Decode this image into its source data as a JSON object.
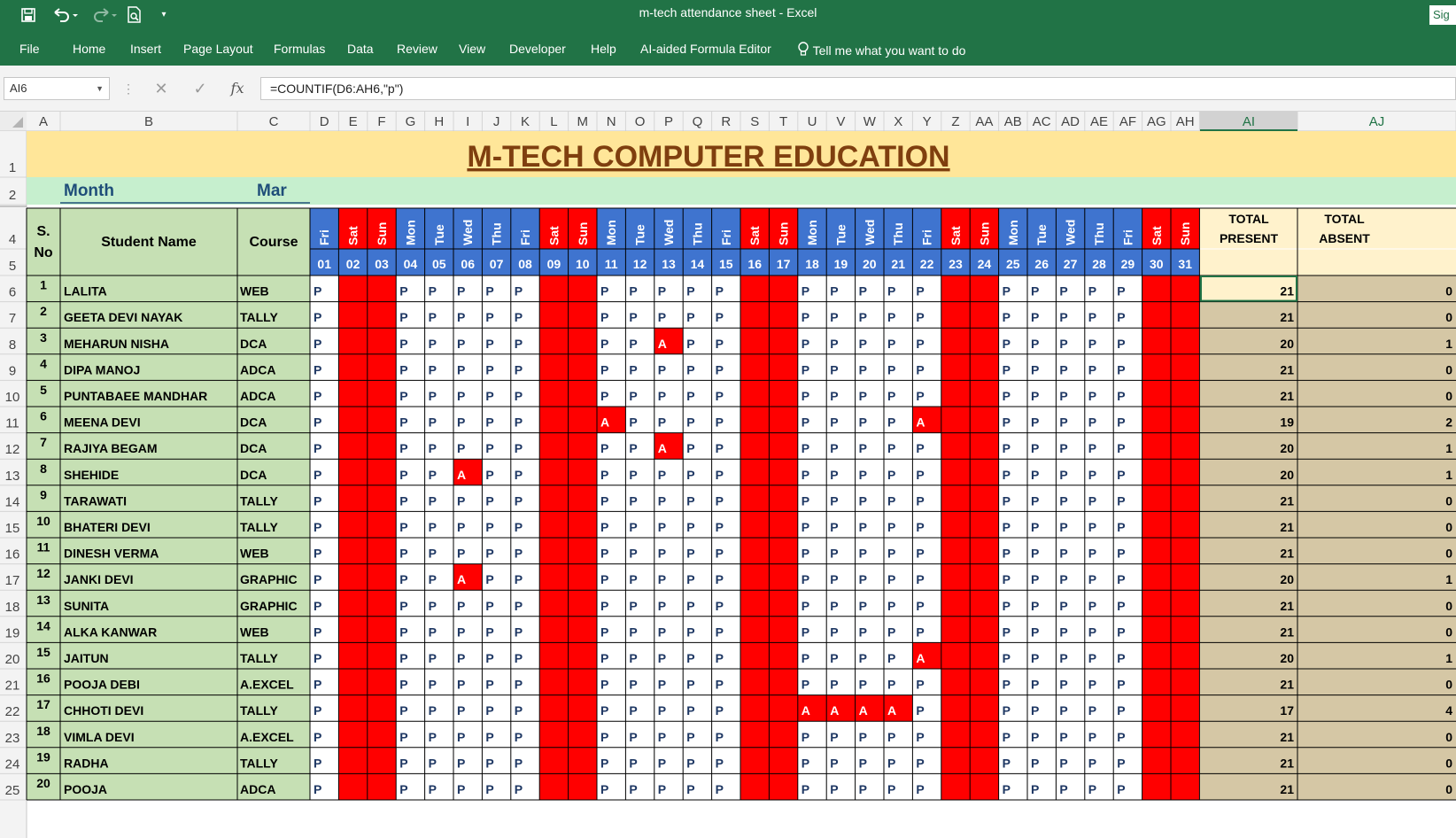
{
  "window": {
    "title": "m-tech attendance sheet  -  Excel",
    "sign_in": "Sig"
  },
  "quick_access": {
    "icons": [
      "save-icon",
      "undo-icon",
      "redo-icon",
      "print-preview-icon",
      "customize-icon"
    ]
  },
  "ribbon": {
    "tabs": [
      "File",
      "Home",
      "Insert",
      "Page Layout",
      "Formulas",
      "Data",
      "Review",
      "View",
      "Developer",
      "Help",
      "AI-aided Formula Editor",
      "Tell me what you want to do"
    ]
  },
  "formula_bar": {
    "name_box": "AI6",
    "formula": "=COUNTIF(D6:AH6,\"p\")",
    "fx_label": "fx"
  },
  "colors": {
    "excel_green": "#217346",
    "weekend_red": "#ff0000",
    "weekday_blue": "#3f74cf",
    "title_fill": "#ffe699",
    "title_text": "#7f3f0f",
    "student_fill": "#c6e0b4",
    "month_fill": "#c6efce",
    "total_present_fill": "#fff2cc",
    "total_absent_fill": "#d5c7a5"
  },
  "sheet": {
    "columns": [
      "A",
      "B",
      "C",
      "D",
      "E",
      "F",
      "G",
      "H",
      "I",
      "J",
      "K",
      "L",
      "M",
      "N",
      "O",
      "P",
      "Q",
      "R",
      "S",
      "T",
      "U",
      "V",
      "W",
      "X",
      "Y",
      "Z",
      "AA",
      "AB",
      "AC",
      "AD",
      "AE",
      "AF",
      "AG",
      "AH",
      "AI",
      "AJ"
    ],
    "row_numbers": [
      "1",
      "2",
      "4",
      "5",
      "6",
      "7",
      "8",
      "9",
      "10",
      "11",
      "12",
      "13",
      "14",
      "15",
      "16",
      "17",
      "18",
      "19",
      "20",
      "21",
      "22",
      "23",
      "24",
      "25"
    ],
    "title": "M-TECH COMPUTER EDUCATION",
    "month_label": "Month",
    "month_value": "Mar",
    "headers": {
      "sno": "S.\nNo",
      "name": "Student Name",
      "course": "Course",
      "total_present": "TOTAL\nPRESENT",
      "total_absent": "TOTAL\nABSENT"
    },
    "days": [
      "Fri",
      "Sat",
      "Sun",
      "Mon",
      "Tue",
      "Wed",
      "Thu",
      "Fri",
      "Sat",
      "Sun",
      "Mon",
      "Tue",
      "Wed",
      "Thu",
      "Fri",
      "Sat",
      "Sun",
      "Mon",
      "Tue",
      "Wed",
      "Thu",
      "Fri",
      "Sat",
      "Sun",
      "Mon",
      "Tue",
      "Wed",
      "Thu",
      "Fri",
      "Sat",
      "Sun"
    ],
    "dates": [
      "01",
      "02",
      "03",
      "04",
      "05",
      "06",
      "07",
      "08",
      "09",
      "10",
      "11",
      "12",
      "13",
      "14",
      "15",
      "16",
      "17",
      "18",
      "19",
      "20",
      "21",
      "22",
      "23",
      "24",
      "25",
      "26",
      "27",
      "28",
      "29",
      "30",
      "31"
    ],
    "present_mark": "P",
    "absent_mark": "A",
    "students": [
      {
        "sno": "1",
        "name": "LALITA",
        "course": "WEB",
        "absent_dates": [],
        "present": "21",
        "absent": "0"
      },
      {
        "sno": "2",
        "name": "GEETA DEVI NAYAK",
        "course": "TALLY",
        "absent_dates": [],
        "present": "21",
        "absent": "0"
      },
      {
        "sno": "3",
        "name": "MEHARUN NISHA",
        "course": "DCA",
        "absent_dates": [
          "13"
        ],
        "present": "20",
        "absent": "1"
      },
      {
        "sno": "4",
        "name": "DIPA MANOJ",
        "course": "ADCA",
        "absent_dates": [],
        "present": "21",
        "absent": "0"
      },
      {
        "sno": "5",
        "name": "PUNTABAEE MANDHAR",
        "course": "ADCA",
        "absent_dates": [],
        "present": "21",
        "absent": "0"
      },
      {
        "sno": "6",
        "name": "MEENA DEVI",
        "course": "DCA",
        "absent_dates": [
          "11",
          "22"
        ],
        "present": "19",
        "absent": "2"
      },
      {
        "sno": "7",
        "name": "RAJIYA BEGAM",
        "course": "DCA",
        "absent_dates": [
          "13"
        ],
        "present": "20",
        "absent": "1"
      },
      {
        "sno": "8",
        "name": "SHEHIDE",
        "course": "DCA",
        "absent_dates": [
          "06"
        ],
        "present": "20",
        "absent": "1"
      },
      {
        "sno": "9",
        "name": "TARAWATI",
        "course": "TALLY",
        "absent_dates": [],
        "present": "21",
        "absent": "0"
      },
      {
        "sno": "10",
        "name": "BHATERI DEVI",
        "course": "TALLY",
        "absent_dates": [],
        "present": "21",
        "absent": "0"
      },
      {
        "sno": "11",
        "name": "DINESH VERMA",
        "course": "WEB",
        "absent_dates": [],
        "present": "21",
        "absent": "0"
      },
      {
        "sno": "12",
        "name": "JANKI DEVI",
        "course": "GRAPHIC",
        "absent_dates": [
          "06"
        ],
        "present": "20",
        "absent": "1"
      },
      {
        "sno": "13",
        "name": "SUNITA",
        "course": "GRAPHIC",
        "absent_dates": [],
        "present": "21",
        "absent": "0"
      },
      {
        "sno": "14",
        "name": "ALKA KANWAR",
        "course": "WEB",
        "absent_dates": [],
        "present": "21",
        "absent": "0"
      },
      {
        "sno": "15",
        "name": "JAITUN",
        "course": "TALLY",
        "absent_dates": [
          "22"
        ],
        "present": "20",
        "absent": "1"
      },
      {
        "sno": "16",
        "name": "POOJA DEBI",
        "course": "A.EXCEL",
        "absent_dates": [],
        "present": "21",
        "absent": "0"
      },
      {
        "sno": "17",
        "name": "CHHOTI DEVI",
        "course": "TALLY",
        "absent_dates": [
          "18",
          "19",
          "20",
          "21"
        ],
        "present": "17",
        "absent": "4"
      },
      {
        "sno": "18",
        "name": "VIMLA DEVI",
        "course": "A.EXCEL",
        "absent_dates": [],
        "present": "21",
        "absent": "0"
      },
      {
        "sno": "19",
        "name": "RADHA",
        "course": "TALLY",
        "absent_dates": [],
        "present": "21",
        "absent": "0"
      },
      {
        "sno": "20",
        "name": "POOJA",
        "course": "ADCA",
        "absent_dates": [],
        "present": "21",
        "absent": "0"
      }
    ]
  }
}
